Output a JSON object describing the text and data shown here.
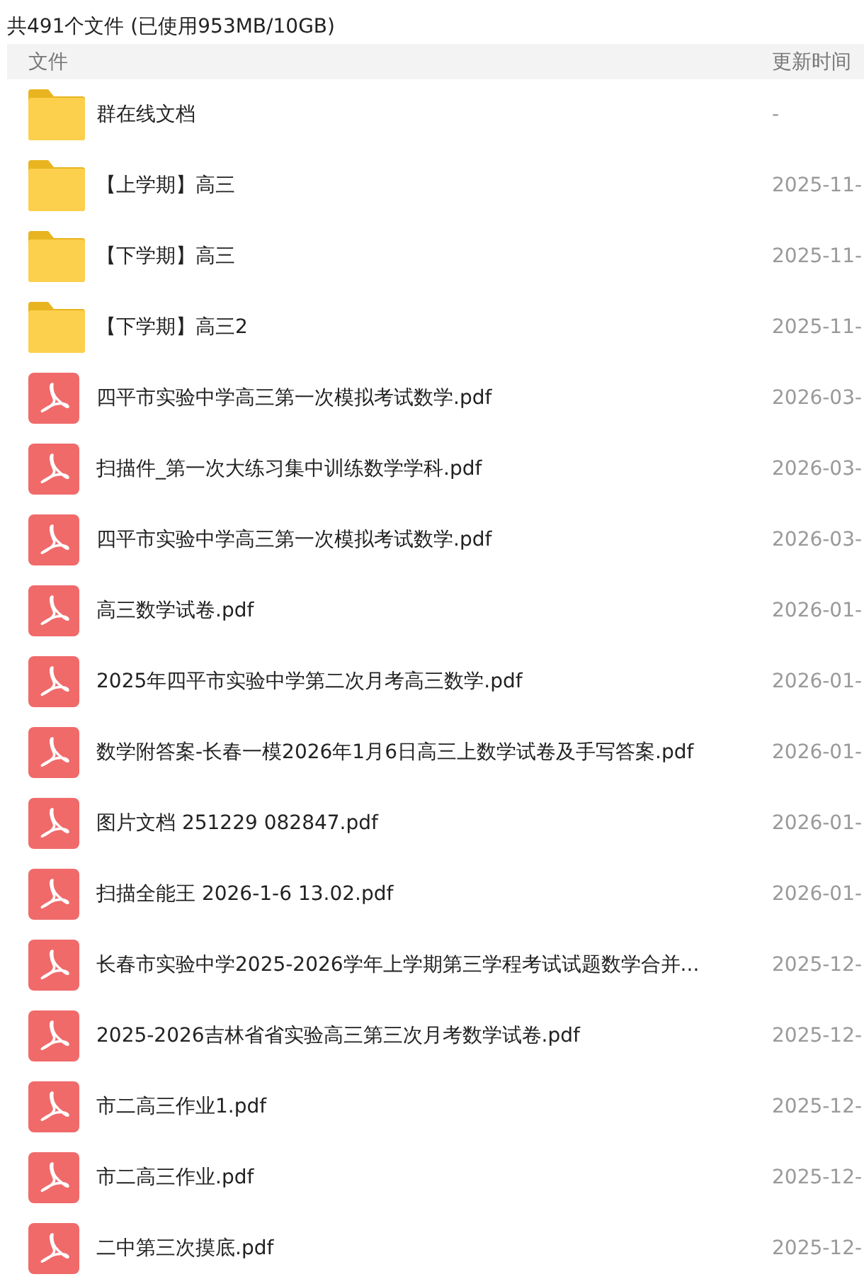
{
  "summary": "共491个文件 (已使用953MB/10GB)",
  "columns": [
    "文件",
    "更新时间"
  ],
  "rows": [
    {
      "kind": "folder",
      "name": "群在线文档",
      "updated": "-"
    },
    {
      "kind": "folder",
      "name": "【上学期】高三",
      "updated": "2025-11-"
    },
    {
      "kind": "folder",
      "name": "【下学期】高三",
      "updated": "2025-11-"
    },
    {
      "kind": "folder",
      "name": "【下学期】高三2",
      "updated": "2025-11-"
    },
    {
      "kind": "pdf",
      "name": "四平市实验中学高三第一次模拟考试数学.pdf",
      "updated": "2026-03-"
    },
    {
      "kind": "pdf",
      "name": "扫描件_第一次大练习集中训练数学学科.pdf",
      "updated": "2026-03-"
    },
    {
      "kind": "pdf",
      "name": "四平市实验中学高三第一次模拟考试数学.pdf",
      "updated": "2026-03-"
    },
    {
      "kind": "pdf",
      "name": "高三数学试卷.pdf",
      "updated": "2026-01-"
    },
    {
      "kind": "pdf",
      "name": "2025年四平市实验中学第二次月考高三数学.pdf",
      "updated": "2026-01-"
    },
    {
      "kind": "pdf",
      "name": "数学附答案-长春一模2026年1月6日高三上数学试卷及手写答案.pdf",
      "updated": "2026-01-"
    },
    {
      "kind": "pdf",
      "name": "图片文档 251229 082847.pdf",
      "updated": "2026-01-"
    },
    {
      "kind": "pdf",
      "name": "扫描全能王 2026-1-6 13.02.pdf",
      "updated": "2026-01-"
    },
    {
      "kind": "pdf",
      "name": "长春市实验中学2025-2026学年上学期第三学程考试试题数学合并...",
      "updated": "2025-12-"
    },
    {
      "kind": "pdf",
      "name": "2025-2026吉林省省实验高三第三次月考数学试卷.pdf",
      "updated": "2025-12-"
    },
    {
      "kind": "pdf",
      "name": "市二高三作业1.pdf",
      "updated": "2025-12-"
    },
    {
      "kind": "pdf",
      "name": "市二高三作业.pdf",
      "updated": "2025-12-"
    },
    {
      "kind": "pdf",
      "name": "二中第三次摸底.pdf",
      "updated": "2025-12-"
    }
  ]
}
